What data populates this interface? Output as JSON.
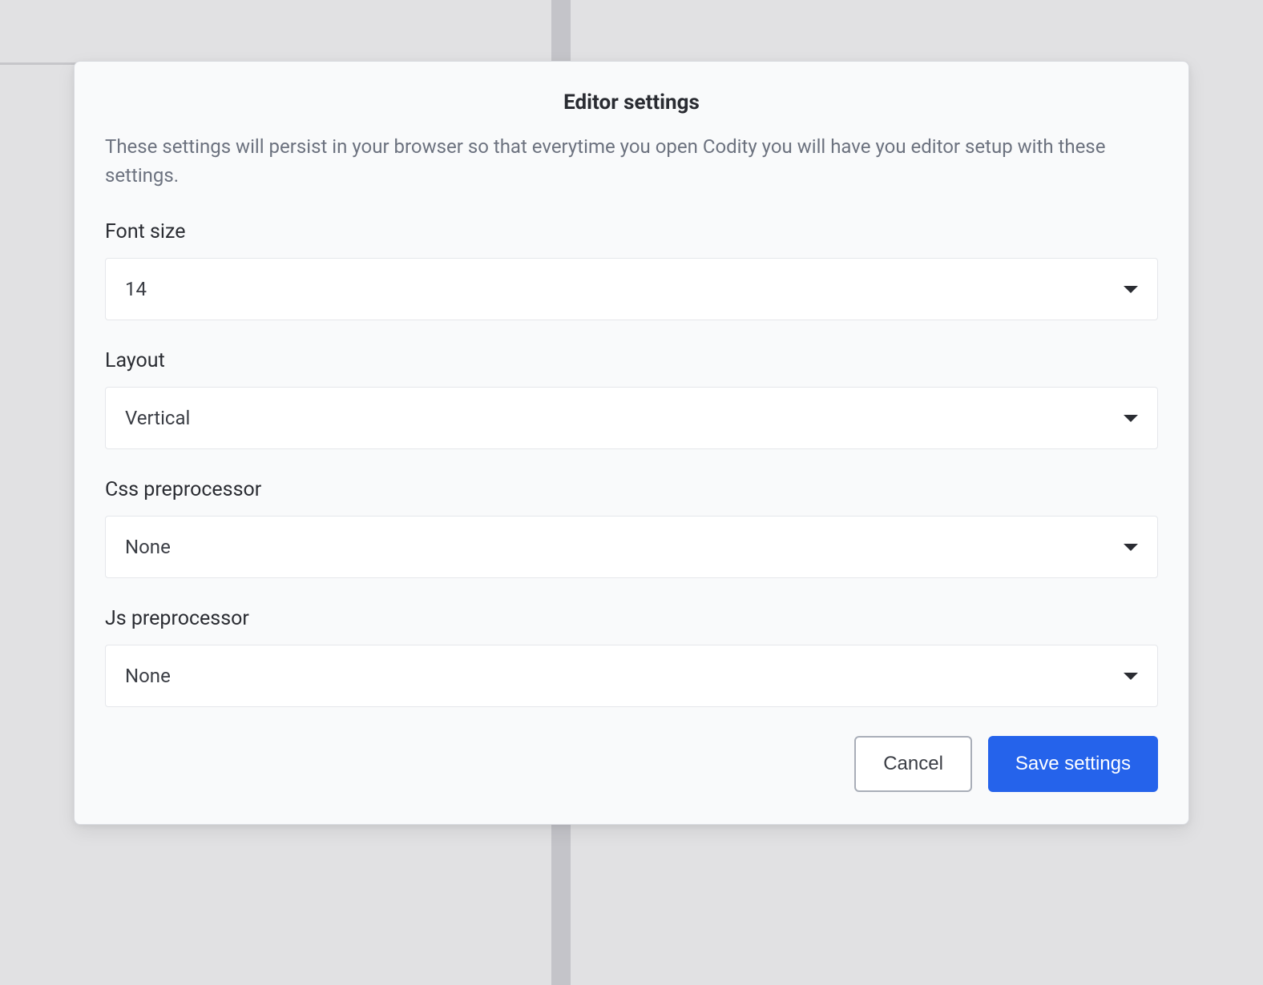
{
  "modal": {
    "title": "Editor settings",
    "description": "These settings will persist in your browser so that everytime you open Codity you will have you editor setup with these settings.",
    "fields": {
      "fontSize": {
        "label": "Font size",
        "value": "14"
      },
      "layout": {
        "label": "Layout",
        "value": "Vertical"
      },
      "cssPreprocessor": {
        "label": "Css preprocessor",
        "value": "None"
      },
      "jsPreprocessor": {
        "label": "Js preprocessor",
        "value": "None"
      }
    },
    "actions": {
      "cancel": "Cancel",
      "save": "Save settings"
    }
  }
}
